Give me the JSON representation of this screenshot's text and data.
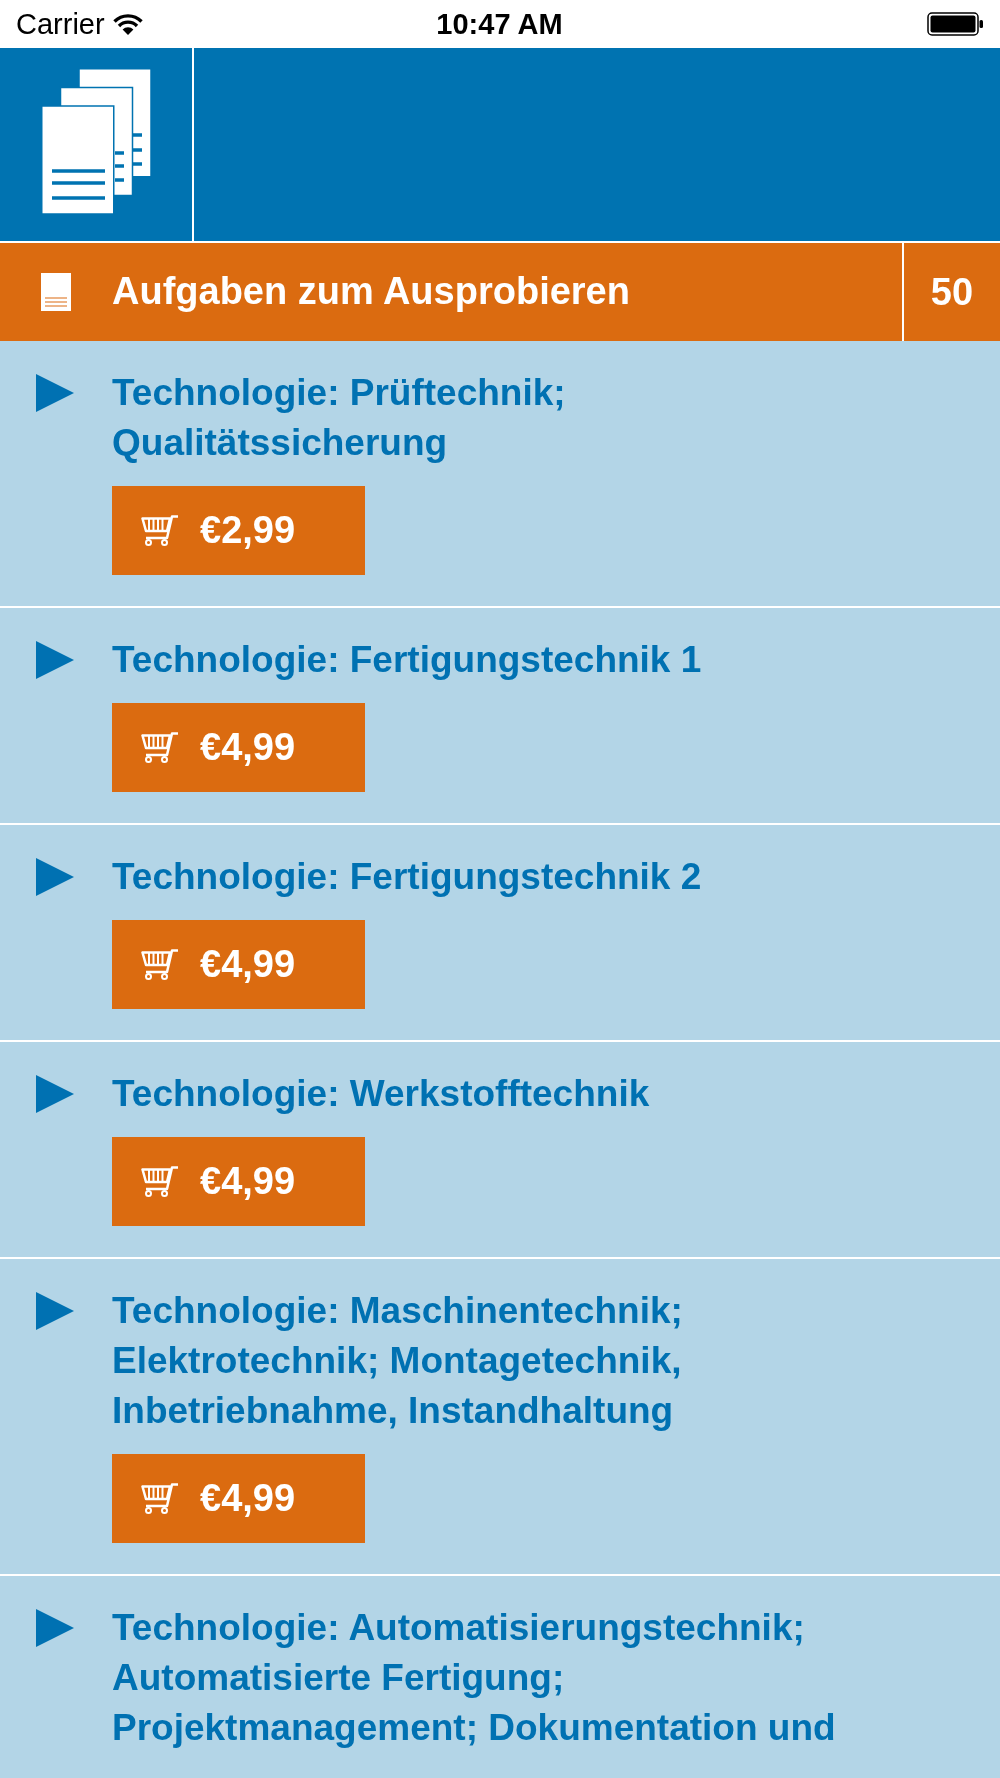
{
  "status_bar": {
    "carrier": "Carrier",
    "time": "10:47 AM"
  },
  "section": {
    "title": "Aufgaben zum Ausprobieren",
    "count": "50"
  },
  "items": [
    {
      "title": "Technologie: Prüftechnik; Qualitätssicherung",
      "expanded": false,
      "price": "€2,99"
    },
    {
      "title": "Technologie: Fertigungstechnik 1",
      "expanded": false,
      "price": "€4,99"
    },
    {
      "title": "Technologie: Fertigungstechnik 2",
      "expanded": false,
      "price": "€4,99"
    },
    {
      "title": "Technologie: Werkstofftechnik",
      "expanded": false,
      "price": "€4,99"
    },
    {
      "title": "Technologie: Maschinentechnik; Elektrotechnik; Montagetechnik, Inbetriebnahme, Instandhaltung",
      "expanded": false,
      "price": "€4,99"
    },
    {
      "title": "Technologie: Automatisierungstechnik; Automatisierte Fertigung; Projektmanagement; Dokumentation und",
      "expanded": false
    }
  ]
}
